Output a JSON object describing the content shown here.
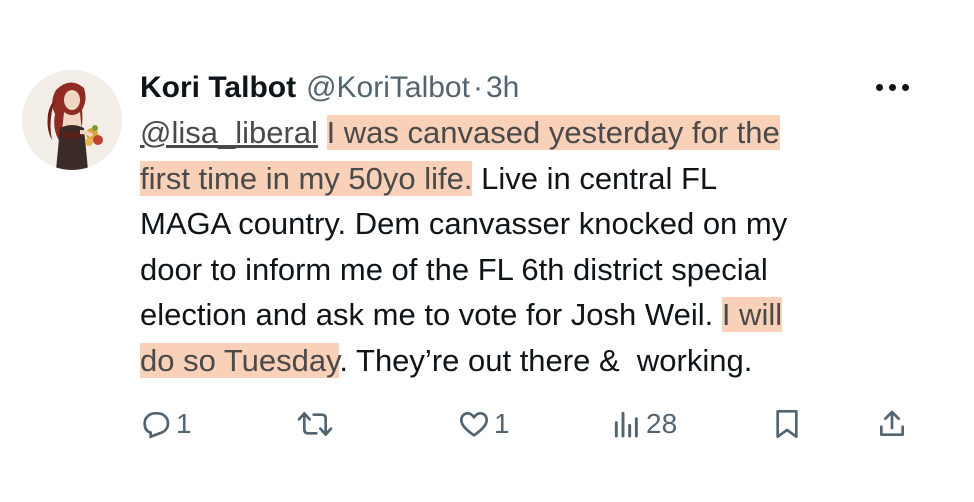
{
  "author": {
    "display_name": "Kori Talbot",
    "handle": "@KoriTalbot",
    "separator": "·",
    "time": "3h"
  },
  "tweet": {
    "lines": [
      [
        {
          "text": "@lisa_liberal",
          "kind": "mention"
        },
        {
          "text": " ",
          "kind": "plain"
        },
        {
          "text": "I was canvased yesterday for the",
          "kind": "highlight"
        }
      ],
      [
        {
          "text": "first time in my 50yo life.",
          "kind": "highlight"
        },
        {
          "text": " Live in central FL",
          "kind": "plain"
        }
      ],
      [
        {
          "text": "MAGA country. Dem canvasser knocked on my",
          "kind": "plain"
        }
      ],
      [
        {
          "text": "door to inform me of the FL 6th district special",
          "kind": "plain"
        }
      ],
      [
        {
          "text": "election and ask me to vote for Josh Weil. ",
          "kind": "plain"
        },
        {
          "text": "I will",
          "kind": "highlight"
        }
      ],
      [
        {
          "text": "do so Tuesday",
          "kind": "highlight"
        },
        {
          "text": ". They’re out there &  working.",
          "kind": "plain"
        }
      ]
    ],
    "highlight_color": "#f9d0b8"
  },
  "actions": {
    "reply_count": "1",
    "retweet_count": "",
    "like_count": "1",
    "views_count": "28"
  },
  "icons": {
    "more": "more-icon",
    "reply": "reply-icon",
    "retweet": "retweet-icon",
    "like": "heart-icon",
    "views": "views-icon",
    "bookmark": "bookmark-icon",
    "share": "share-icon"
  },
  "colors": {
    "text": "#0f1419",
    "secondary": "#536471",
    "highlight": "#f9d0b8"
  }
}
